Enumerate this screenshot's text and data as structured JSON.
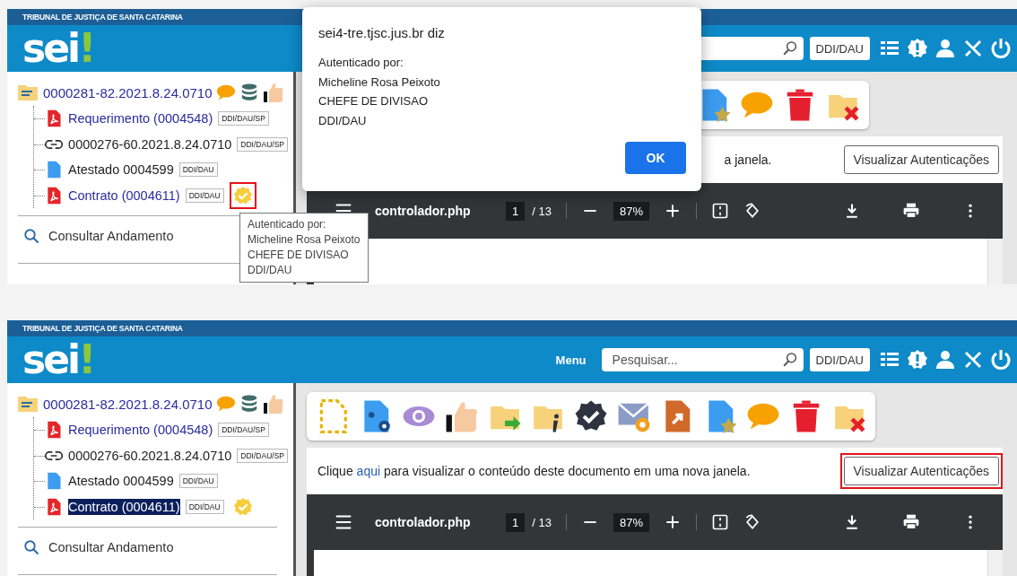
{
  "panels": [
    {
      "kind": "dialog",
      "header": {
        "court": "TRIBUNAL DE JUSTIÇA DE SANTA CATARINA",
        "logo": "sei",
        "logo_mark": "!",
        "unit": "DDI/DAU"
      },
      "tree": {
        "label": "0000281-82.2021.8.24.0710",
        "children": [
          {
            "kind": "pdf",
            "label": "Requerimento (0004548)",
            "tag": "DDI/DAU/SP",
            "selected": false,
            "authenticated": false,
            "highlighted": false
          },
          {
            "kind": "link",
            "label": "0000276-60.2021.8.24.0710",
            "tag": "DDI/DAU/SP",
            "selected": false,
            "authenticated": false,
            "highlighted": false
          },
          {
            "kind": "doc",
            "label": "Atestado 0004599",
            "tag": "DDI/DAU",
            "selected": false,
            "authenticated": false,
            "highlighted": false
          },
          {
            "kind": "pdf",
            "label": "Contrato (0004611)",
            "tag": "DDI/DAU",
            "selected": false,
            "authenticated": true,
            "highlighted": true
          }
        ]
      },
      "sidebar_link": "Consultar Andamento",
      "info": [
        {
          "kind": "text",
          "text": "a janela."
        }
      ],
      "auth_button": {
        "label": "Visualizar Autenticações",
        "highlighted": false
      },
      "pdf": {
        "file": "controlador.php",
        "page": "1",
        "pages": "/ 13",
        "zoom": "87%"
      },
      "tooltip": [
        "Autenticado por:",
        "Micheline Rosa Peixoto",
        "CHEFE DE DIVISAO",
        "DDI/DAU"
      ],
      "dialog": {
        "title": "sei4-tre.tjsc.jus.br diz",
        "lines": [
          "Autenticado por:",
          "Micheline Rosa Peixoto",
          "CHEFE DE DIVISAO",
          "DDI/DAU"
        ],
        "button": "OK"
      }
    },
    {
      "kind": "plain",
      "header": {
        "court": "TRIBUNAL DE JUSTIÇA DE SANTA CATARINA",
        "logo": "sei",
        "logo_mark": "!",
        "unit": "DDI/DAU"
      },
      "menu": "Menu",
      "search": {
        "placeholder": "Pesquisar..."
      },
      "tree": {
        "label": "0000281-82.2021.8.24.0710",
        "children": [
          {
            "kind": "pdf",
            "label": "Requerimento (0004548)",
            "tag": "DDI/DAU/SP",
            "selected": false,
            "authenticated": false,
            "highlighted": false
          },
          {
            "kind": "link",
            "label": "0000276-60.2021.8.24.0710",
            "tag": "DDI/DAU/SP",
            "selected": false,
            "authenticated": false,
            "highlighted": false
          },
          {
            "kind": "doc",
            "label": "Atestado 0004599",
            "tag": "DDI/DAU",
            "selected": false,
            "authenticated": false,
            "highlighted": false
          },
          {
            "kind": "pdf",
            "label": "Contrato (0004611)",
            "tag": "DDI/DAU",
            "selected": true,
            "authenticated": true,
            "highlighted": false
          }
        ]
      },
      "sidebar_link": "Consultar Andamento",
      "info": [
        {
          "kind": "text",
          "text": "Clique "
        },
        {
          "kind": "link",
          "text": "aqui"
        },
        {
          "kind": "text",
          "text": " para visualizar o conteúdo deste documento em uma nova janela."
        }
      ],
      "auth_button": {
        "label": "Visualizar Autenticações",
        "highlighted": true
      },
      "pdf": {
        "file": "controlador.php",
        "page": "1",
        "pages": "/ 13",
        "zoom": "87%"
      }
    }
  ]
}
